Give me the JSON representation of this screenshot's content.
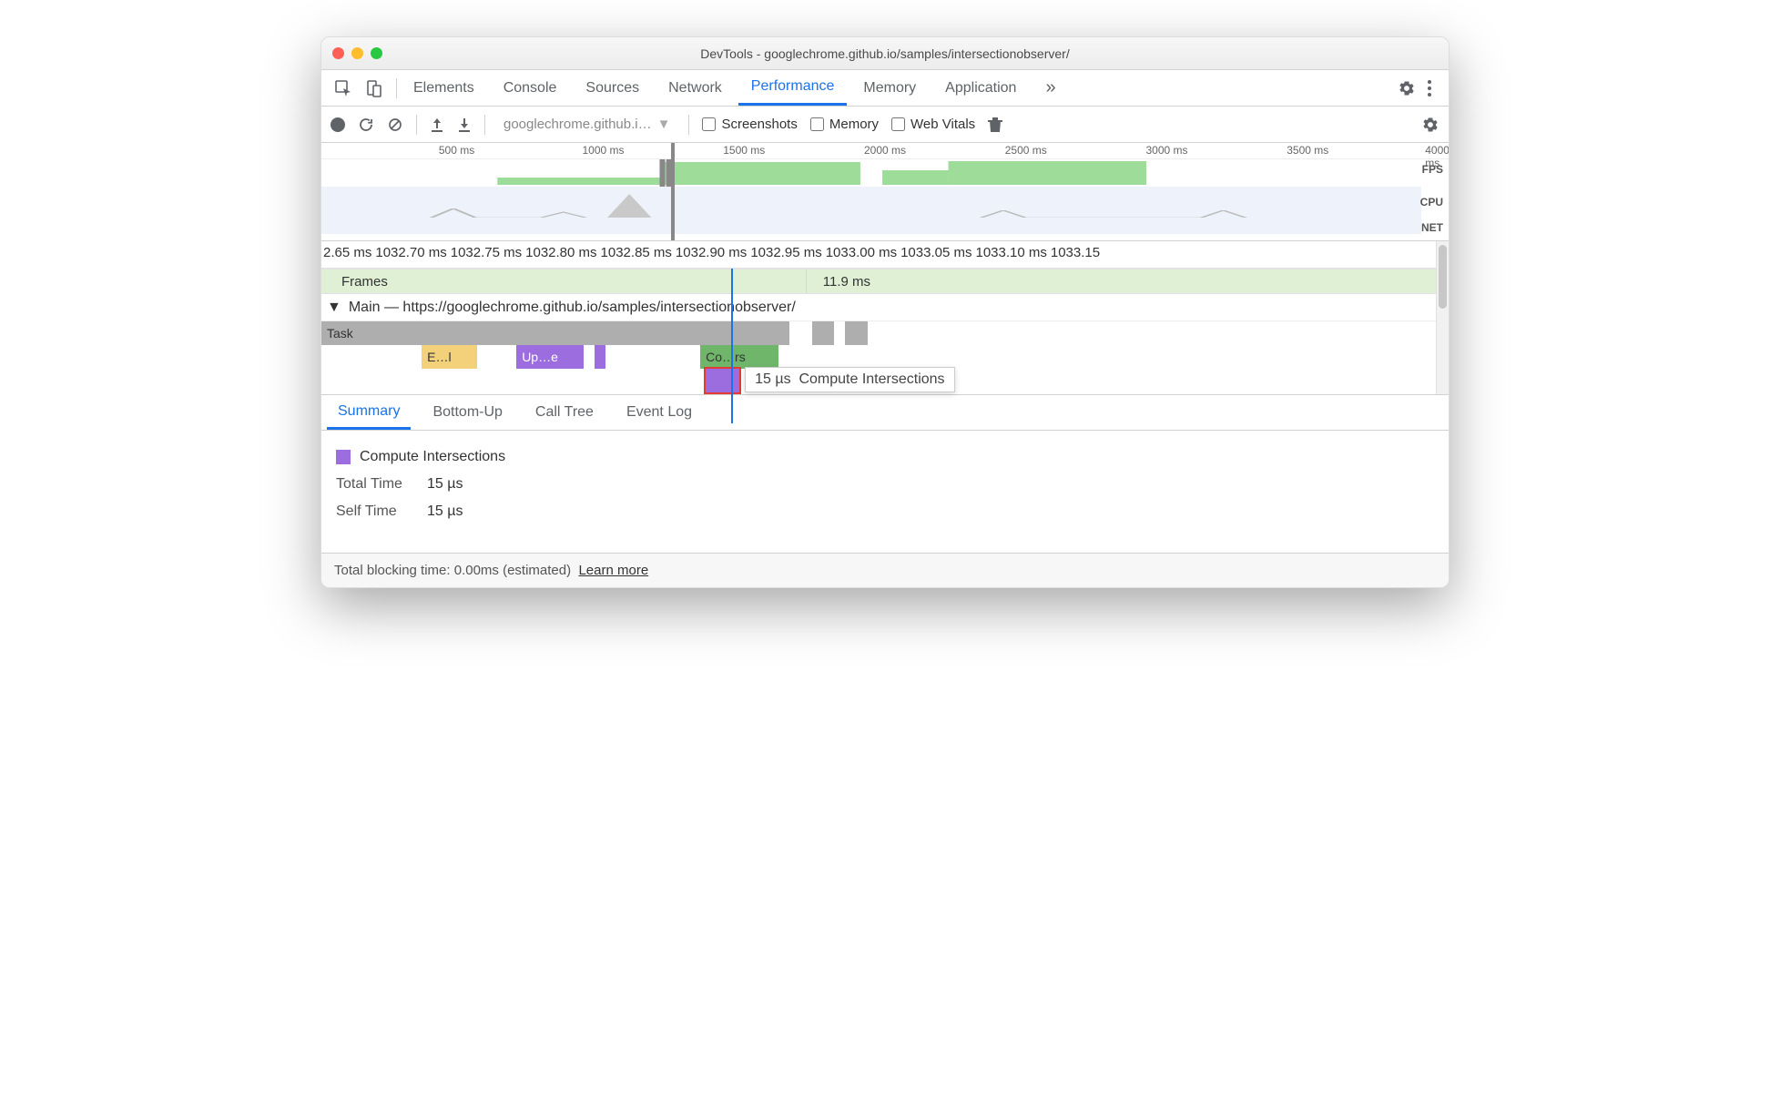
{
  "window": {
    "title": "DevTools - googlechrome.github.io/samples/intersectionobserver/"
  },
  "tabs": {
    "items": [
      "Elements",
      "Console",
      "Sources",
      "Network",
      "Performance",
      "Memory",
      "Application"
    ],
    "active_index": 4,
    "overflow_icon": "»"
  },
  "toolbar": {
    "recording_select": "googlechrome.github.i…",
    "checkboxes": {
      "screenshots": "Screenshots",
      "memory": "Memory",
      "webvitals": "Web Vitals"
    }
  },
  "overview": {
    "ticks": [
      "500 ms",
      "1000 ms",
      "1500 ms",
      "2000 ms",
      "2500 ms",
      "3000 ms",
      "3500 ms",
      "4000 ms"
    ],
    "lanes": {
      "fps": "FPS",
      "cpu": "CPU",
      "net": "NET"
    }
  },
  "fine_ruler": {
    "ticks": [
      "2.65 ms",
      "1032.70 ms",
      "1032.75 ms",
      "1032.80 ms",
      "1032.85 ms",
      "1032.90 ms",
      "1032.95 ms",
      "1033.00 ms",
      "1033.05 ms",
      "1033.10 ms",
      "1033.15"
    ]
  },
  "frames": {
    "label": "Frames",
    "duration": "11.9 ms"
  },
  "main_thread": {
    "header_prefix": "Main —",
    "url": "https://googlechrome.github.io/samples/intersectionobserver/",
    "blocks": {
      "task": "Task",
      "evt": "E…l",
      "update": "Up…e",
      "composite": "Co…rs"
    },
    "tooltip": {
      "time": "15 µs",
      "name": "Compute Intersections"
    }
  },
  "detail_tabs": {
    "items": [
      "Summary",
      "Bottom-Up",
      "Call Tree",
      "Event Log"
    ],
    "active_index": 0
  },
  "summary": {
    "event_name": "Compute Intersections",
    "event_color": "#9b6dde",
    "rows": [
      {
        "label": "Total Time",
        "value": "15 µs"
      },
      {
        "label": "Self Time",
        "value": "15 µs"
      }
    ]
  },
  "footer": {
    "text_prefix": "Total blocking time: 0.00ms (estimated)",
    "link": "Learn more"
  },
  "colors": {
    "task_grey": "#aeaeae",
    "evt_yellow": "#f3d07a",
    "update_purple": "#9b6dde",
    "composite_green": "#6fb66a",
    "selected_red_outline": "#e53935",
    "fps_green": "#9edc9a",
    "overview_bg": "#eef2fb"
  }
}
